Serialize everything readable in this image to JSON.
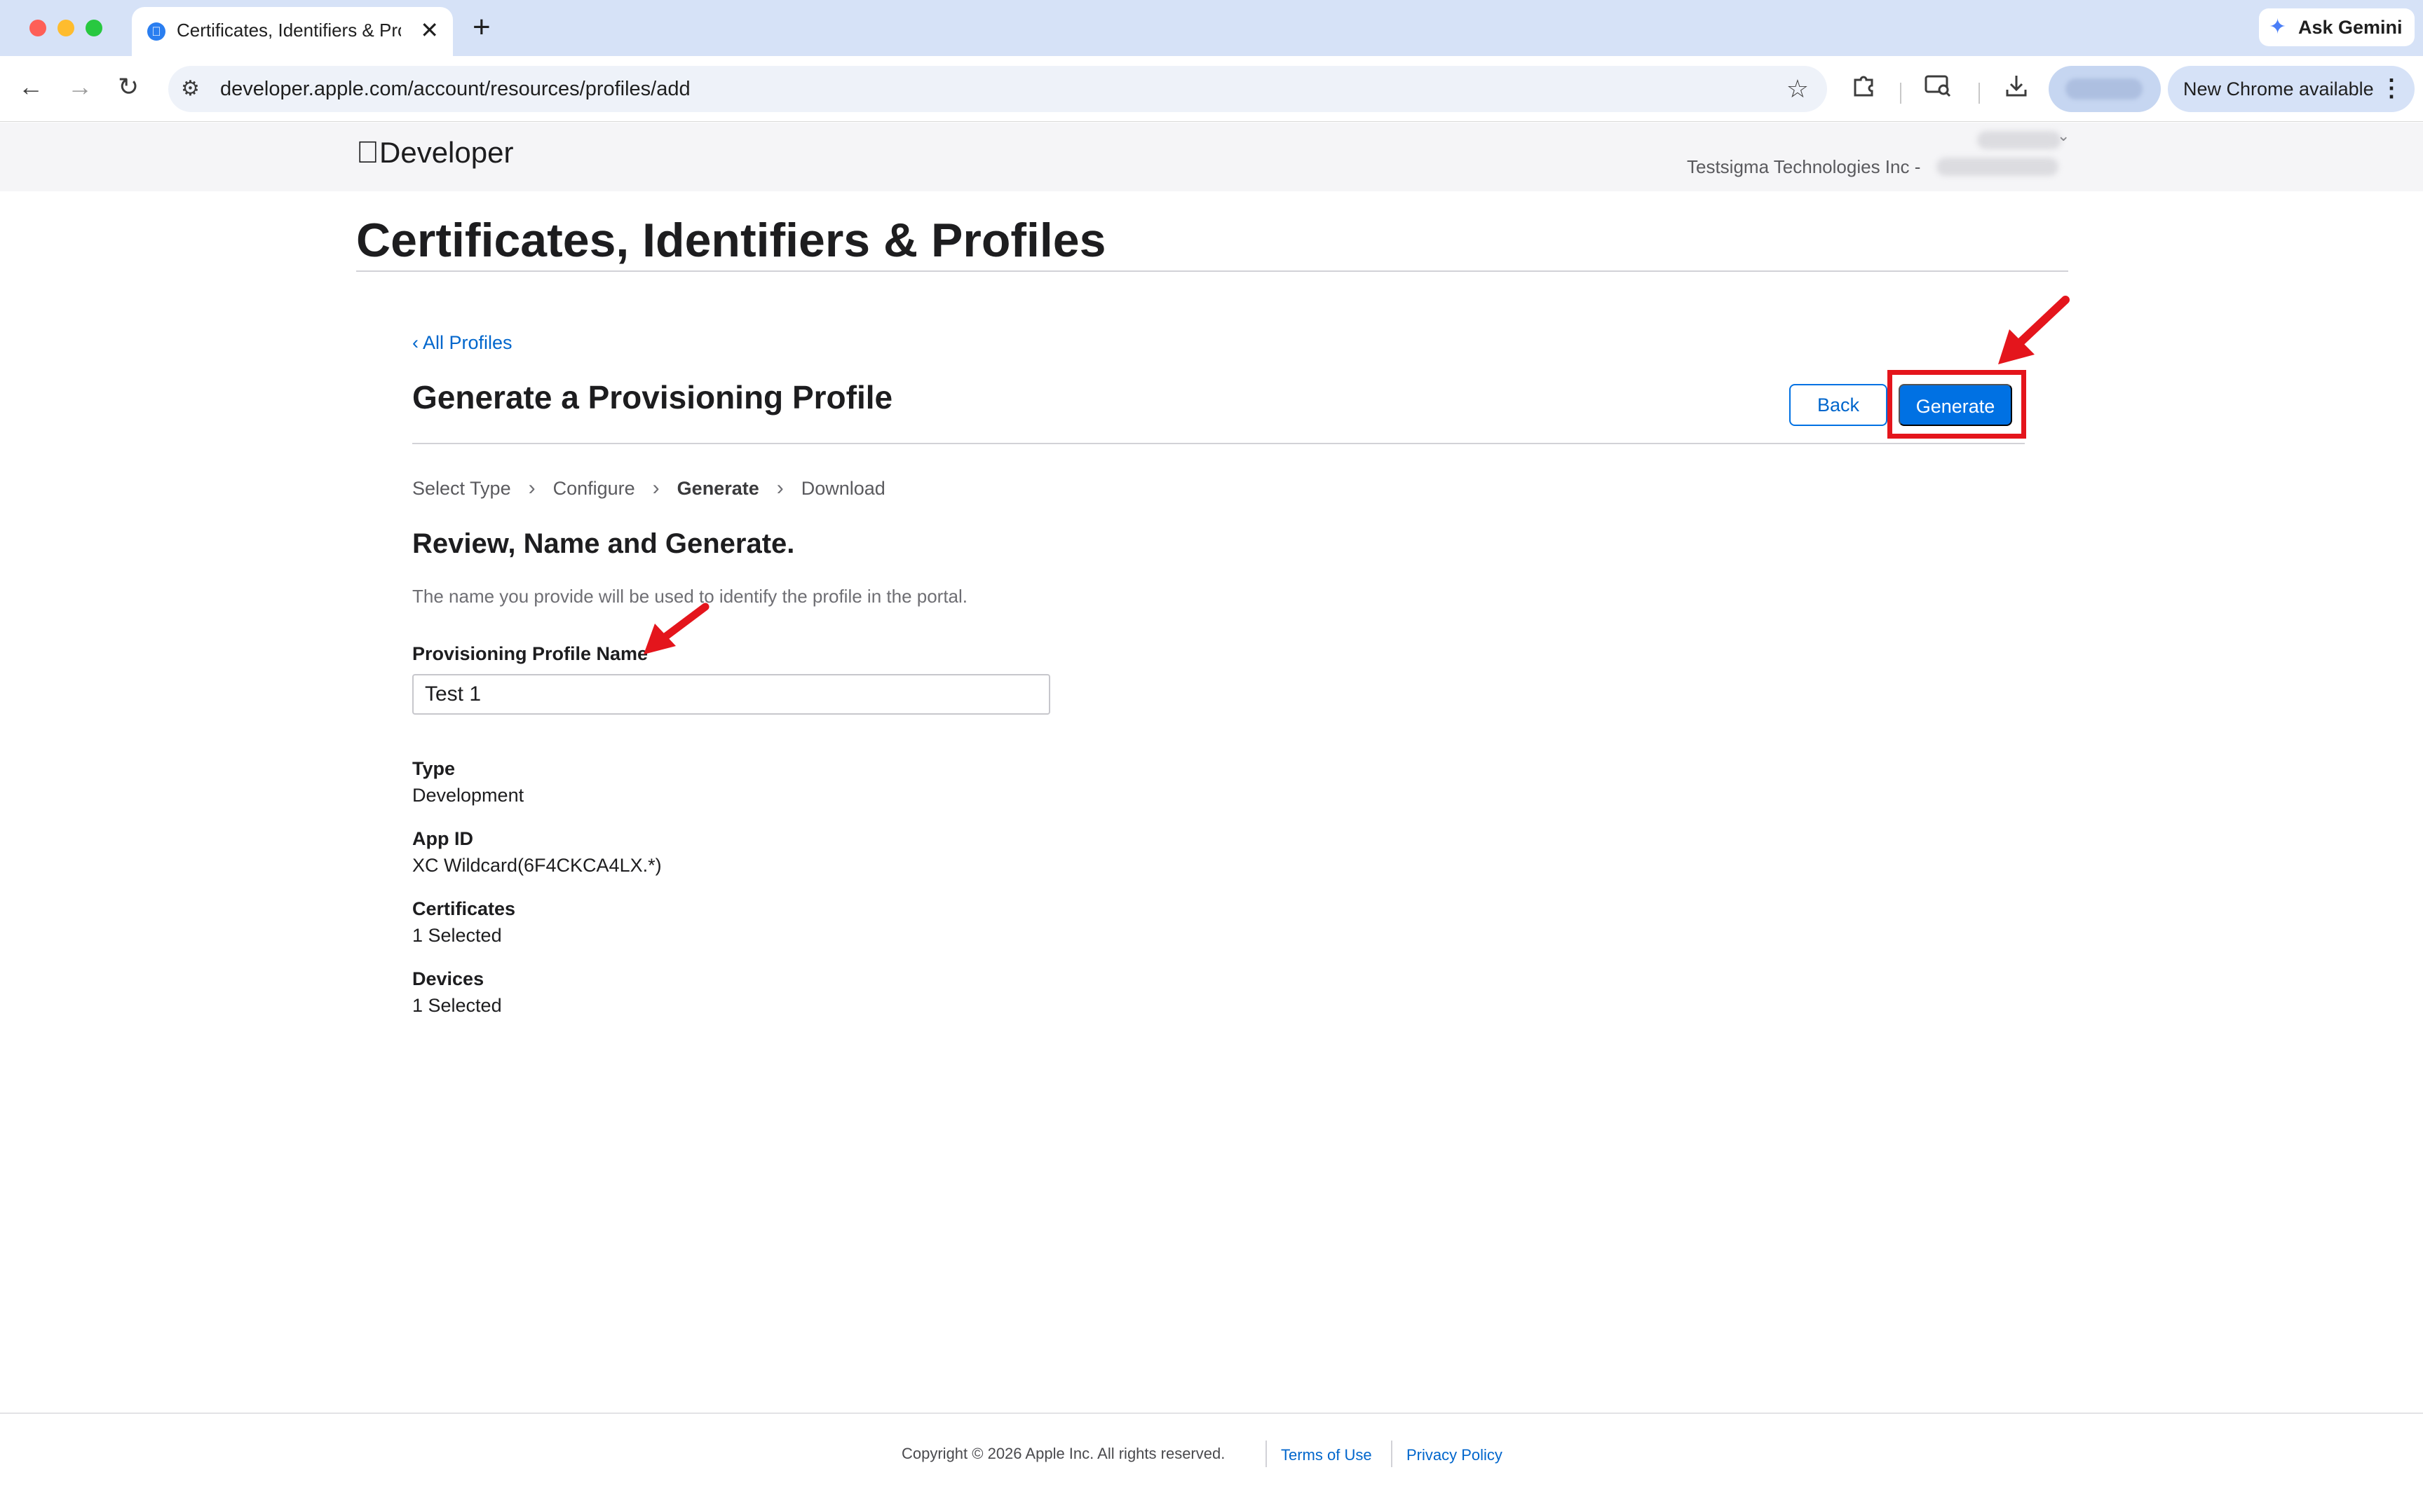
{
  "browser": {
    "tab_title": "Certificates, Identifiers & Pro",
    "new_tab_symbol": "+",
    "gemini_label": "Ask Gemini",
    "url": "developer.apple.com/account/resources/profiles/add",
    "update_label": "New Chrome available"
  },
  "header": {
    "brand": "Developer",
    "team_name": "Testsigma Technologies Inc -"
  },
  "page": {
    "title": "Certificates, Identifiers & Profiles",
    "back_link": "‹ All Profiles",
    "section_title": "Generate a Provisioning Profile",
    "back_button": "Back",
    "generate_button": "Generate"
  },
  "steps": [
    "Select Type",
    "Configure",
    "Generate",
    "Download"
  ],
  "form": {
    "heading": "Review, Name and Generate.",
    "help": "The name you provide will be used to identify the profile in the portal.",
    "name_label": "Provisioning Profile Name",
    "name_value": "Test 1"
  },
  "details": [
    {
      "label": "Type",
      "value": "Development"
    },
    {
      "label": "App ID",
      "value": "XC Wildcard(6F4CKCA4LX.*)"
    },
    {
      "label": "Certificates",
      "value": "1 Selected"
    },
    {
      "label": "Devices",
      "value": "1 Selected"
    }
  ],
  "footer": {
    "copyright": "Copyright © 2026 Apple Inc. All rights reserved.",
    "terms": "Terms of Use",
    "privacy": "Privacy Policy"
  },
  "colors": {
    "accent": "#0071e3",
    "link": "#0066cc",
    "annotation": "#e4151c"
  },
  "icons": {
    "back": "arrow-left-icon",
    "forward": "arrow-right-icon",
    "reload": "reload-icon",
    "site_info": "tune-icon",
    "bookmark": "star-icon",
    "extensions": "puzzle-icon",
    "downloads": "download-icon",
    "menu": "more-vertical-icon"
  }
}
